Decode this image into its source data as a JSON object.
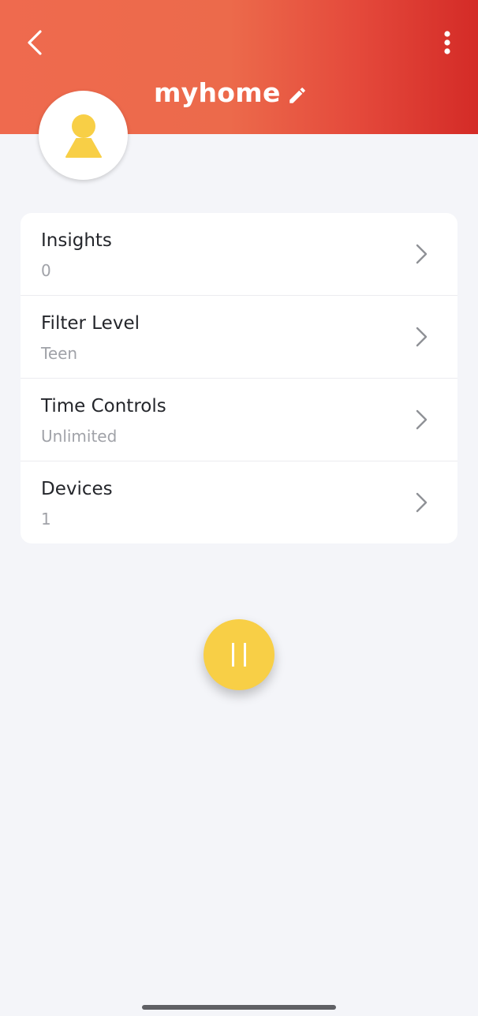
{
  "header": {
    "title": "myhome",
    "back_icon": "chevron-left-icon",
    "menu_icon": "more-vertical-icon",
    "edit_icon": "pencil-icon"
  },
  "avatar": {
    "icon": "person-icon",
    "color": "#f8cf46"
  },
  "settings": {
    "items": [
      {
        "label": "Insights",
        "value": "0"
      },
      {
        "label": "Filter Level",
        "value": "Teen"
      },
      {
        "label": "Time Controls",
        "value": "Unlimited"
      },
      {
        "label": "Devices",
        "value": "1"
      }
    ]
  },
  "pause": {
    "icon": "pause-icon",
    "color": "#f8cf46"
  },
  "colors": {
    "header_start": "#ef6a4e",
    "header_end": "#d42b27",
    "background": "#f4f5f9",
    "accent": "#f8cf46"
  }
}
